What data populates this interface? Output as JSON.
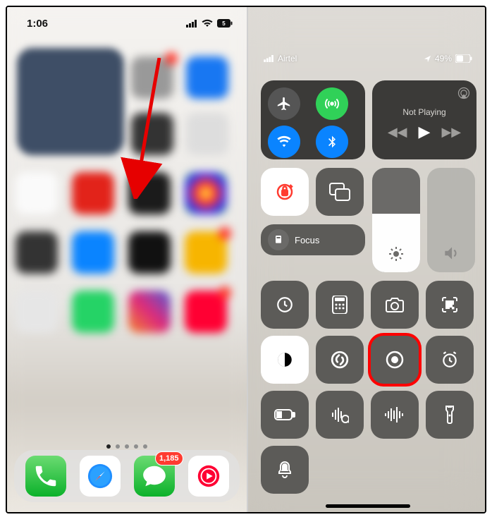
{
  "homescreen": {
    "time": "1:06",
    "dock_badge": "1,185",
    "pages": 5,
    "current_page": 1
  },
  "control_center": {
    "carrier": "Airtel",
    "battery_pct": "49%",
    "media_title": "Not Playing",
    "focus_label": "Focus"
  }
}
